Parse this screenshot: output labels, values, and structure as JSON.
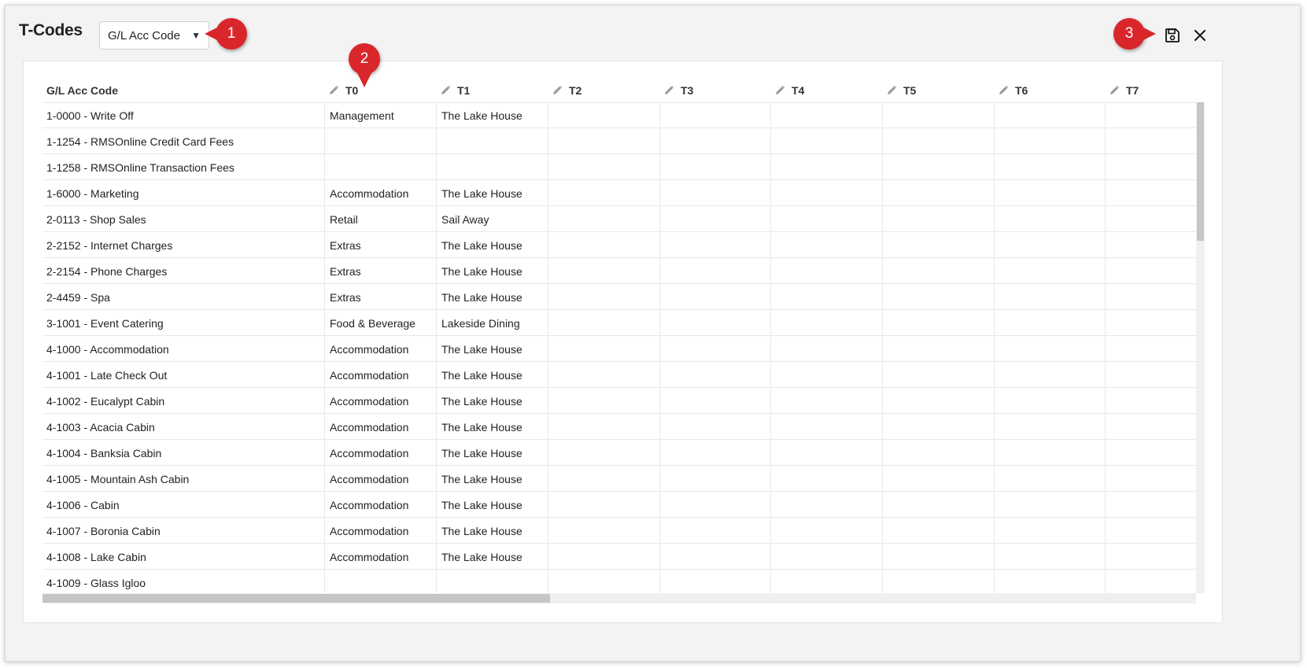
{
  "window": {
    "title": "T-Codes",
    "select": {
      "value": "G/L Acc Code"
    }
  },
  "callouts": [
    "1",
    "2",
    "3"
  ],
  "colors": {
    "callout": "#d9262b",
    "background": "#f3f3f3"
  },
  "icons": {
    "save": "save-icon",
    "close": "close-icon",
    "edit": "pencil-icon"
  },
  "table": {
    "columns": [
      "G/L Acc Code",
      "T0",
      "T1",
      "T2",
      "T3",
      "T4",
      "T5",
      "T6",
      "T7"
    ],
    "rows": [
      [
        "1-0000 - Write Off",
        "Management",
        "The Lake House"
      ],
      [
        "1-1254 - RMSOnline Credit Card Fees",
        "",
        ""
      ],
      [
        "1-1258 - RMSOnline Transaction Fees",
        "",
        ""
      ],
      [
        "1-6000 - Marketing",
        "Accommodation",
        "The Lake House"
      ],
      [
        "2-0113 - Shop Sales",
        "Retail",
        "Sail Away"
      ],
      [
        "2-2152 - Internet Charges",
        "Extras",
        "The Lake House"
      ],
      [
        "2-2154 - Phone Charges",
        "Extras",
        "The Lake House"
      ],
      [
        "2-4459 - Spa",
        "Extras",
        "The Lake House"
      ],
      [
        "3-1001 - Event Catering",
        "Food & Beverage",
        "Lakeside Dining"
      ],
      [
        "4-1000 - Accommodation",
        "Accommodation",
        "The Lake House"
      ],
      [
        "4-1001 - Late Check Out",
        "Accommodation",
        "The Lake House"
      ],
      [
        "4-1002 - Eucalypt Cabin",
        "Accommodation",
        "The Lake House"
      ],
      [
        "4-1003 - Acacia Cabin",
        "Accommodation",
        "The Lake House"
      ],
      [
        "4-1004 - Banksia Cabin",
        "Accommodation",
        "The Lake House"
      ],
      [
        "4-1005 - Mountain Ash Cabin",
        "Accommodation",
        "The Lake House"
      ],
      [
        "4-1006 - Cabin",
        "Accommodation",
        "The Lake House"
      ],
      [
        "4-1007 - Boronia Cabin",
        "Accommodation",
        "The Lake House"
      ],
      [
        "4-1008 - Lake Cabin",
        "Accommodation",
        "The Lake House"
      ],
      [
        "4-1009 - Glass Igloo",
        "",
        ""
      ]
    ]
  }
}
